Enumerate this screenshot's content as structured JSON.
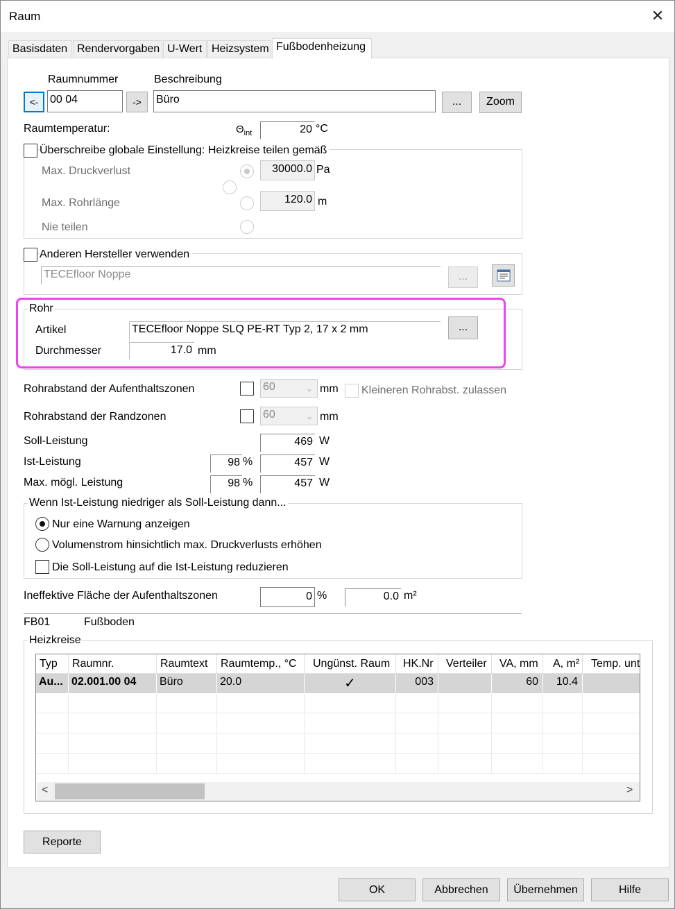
{
  "window": {
    "title": "Raum",
    "close_glyph": "✕"
  },
  "tabs": [
    {
      "label": "Basisdaten"
    },
    {
      "label": "Rendervorgaben"
    },
    {
      "label": "U-Wert"
    },
    {
      "label": "Heizsystem"
    },
    {
      "label": "Fußbodenheizung"
    }
  ],
  "room": {
    "nummer_label": "Raumnummer",
    "beschreibung_label": "Beschreibung",
    "prev_label": "<-",
    "next_label": "->",
    "nummer_value": "00 04",
    "beschreibung_value": "Büro",
    "dots_label": "...",
    "zoom_label": "Zoom"
  },
  "temperature": {
    "label": "Raumtemperatur:",
    "symbol": "Θ",
    "symbol_sub": "int",
    "value": "20",
    "unit": "°C"
  },
  "heizkreise_teilen": {
    "checkbox_label": "Überschreibe globale Einstellung: Heizkreise teilen gemäß",
    "druckverlust_label": "Max. Druckverlust",
    "druckverlust_value": "30000.0",
    "druckverlust_unit": "Pa",
    "rohrlaenge_label": "Max. Rohrlänge",
    "rohrlaenge_value": "120.0",
    "rohrlaenge_unit": "m",
    "nie_label": "Nie teilen"
  },
  "hersteller": {
    "checkbox_label": "Anderen Hersteller verwenden",
    "value": "TECEfloor Noppe",
    "dots_label": "..."
  },
  "rohr": {
    "group_label": "Rohr",
    "artikel_label": "Artikel",
    "artikel_value": "TECEfloor Noppe SLQ PE-RT Typ 2, 17 x 2 mm",
    "dots_label": "...",
    "durchmesser_label": "Durchmesser",
    "durchmesser_value": "17.0",
    "durchmesser_unit": "mm"
  },
  "rohrabstand": {
    "aufenthalt_label": "Rohrabstand der Aufenthaltszonen",
    "aufenthalt_value": "60",
    "aufenthalt_unit": "mm",
    "kleineren_label": "Kleineren Rohrabst. zulassen",
    "rand_label": "Rohrabstand der Randzonen",
    "rand_value": "60",
    "rand_unit": "mm"
  },
  "leistung": {
    "soll_label": "Soll-Leistung",
    "soll_value": "469",
    "ist_label": "Ist-Leistung",
    "ist_pct": "98",
    "ist_value": "457",
    "max_label": "Max. mögl. Leistung",
    "max_pct": "98",
    "max_value": "457",
    "pct_unit": "%",
    "w_unit": "W"
  },
  "wenn": {
    "group_label": "Wenn Ist-Leistung niedriger als Soll-Leistung dann...",
    "opt1": "Nur eine Warnung anzeigen",
    "opt2": "Volumenstrom hinsichtlich max. Druckverlusts erhöhen",
    "opt3": "Die Soll-Leistung auf die Ist-Leistung reduzieren"
  },
  "ineffektiv": {
    "label": "Ineffektive Fläche der Aufenthaltszonen",
    "pct_value": "0",
    "pct_unit": "%",
    "m2_value": "0.0",
    "m2_unit": "m²"
  },
  "boden": {
    "code": "FB01",
    "name": "Fußboden"
  },
  "heizkreise": {
    "group_label": "Heizkreise",
    "columns": [
      "Typ",
      "Raumnr.",
      "Raumtext",
      "Raumtemp., °C",
      "Ungünst. Raum",
      "HK.Nr",
      "Verteiler",
      "VA, mm",
      "A, m²",
      "Temp. unt"
    ],
    "row": {
      "typ": "Au...",
      "raumnr": "02.001.00 04",
      "raumtext": "Büro",
      "raumtemp": "20.0",
      "unguenst": "✓",
      "hknr": "003",
      "verteiler": "",
      "va": "60",
      "a": "10.4",
      "temp": ""
    }
  },
  "scroll": {
    "left": "<",
    "right": ">"
  },
  "buttons": {
    "reporte": "Reporte",
    "ok": "OK",
    "abbrechen": "Abbrechen",
    "uebernehmen": "Übernehmen",
    "hilfe": "Hilfe"
  }
}
